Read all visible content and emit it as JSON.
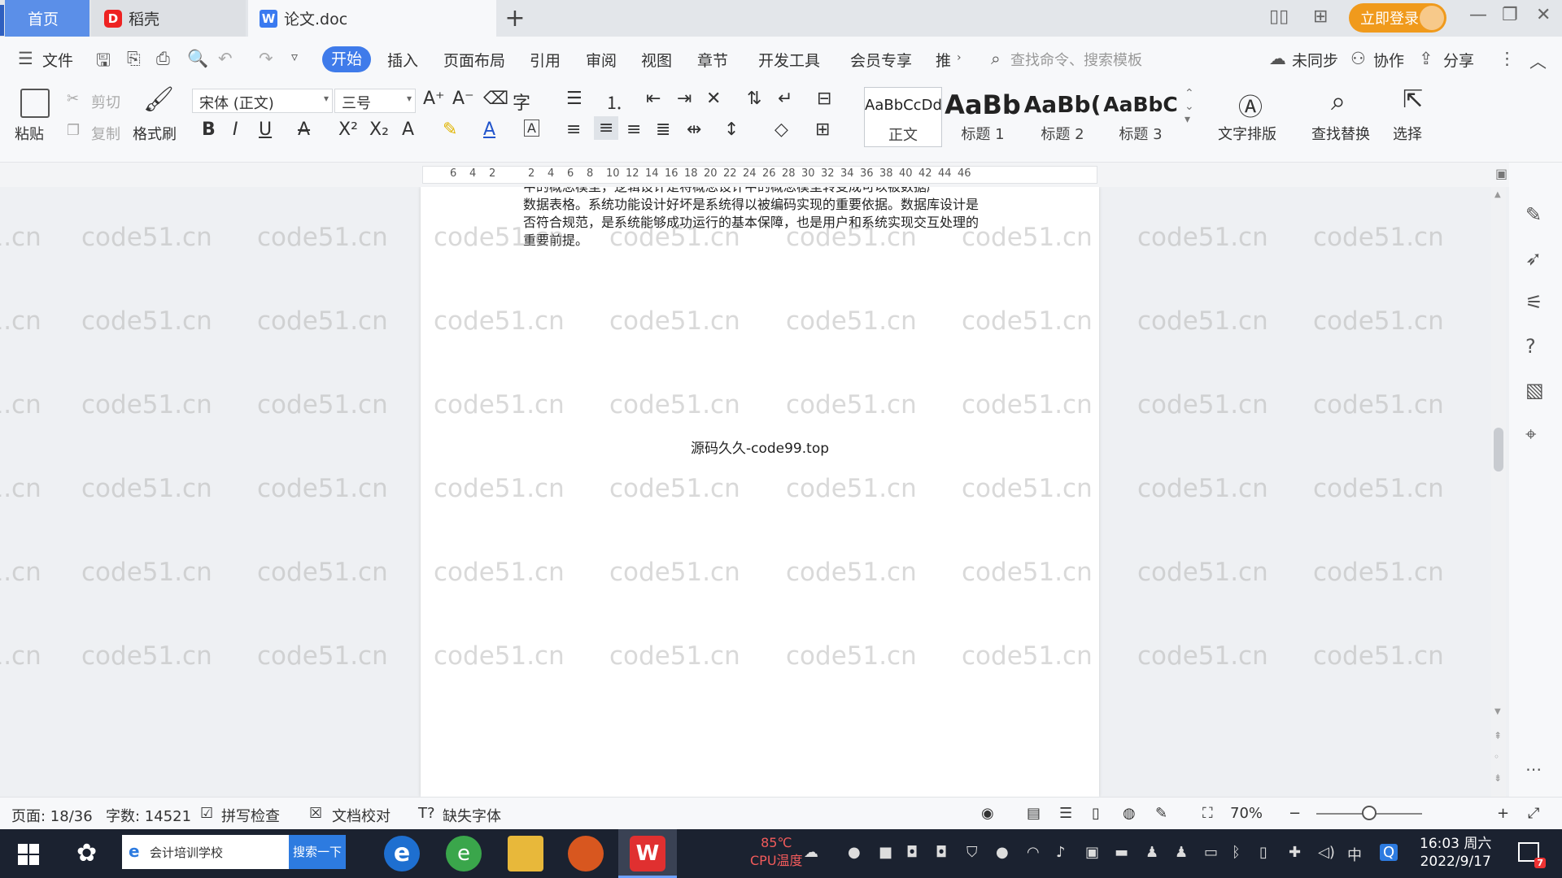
{
  "tabs": {
    "home": "首页",
    "daoke": "稻壳",
    "doc": "论文.doc",
    "add": "+"
  },
  "titlebar": {
    "login": "立即登录"
  },
  "menus": [
    "文件",
    "开始",
    "插入",
    "页面布局",
    "引用",
    "审阅",
    "视图",
    "章节",
    "开发工具",
    "会员专享",
    "推"
  ],
  "search": {
    "command": "查找命令、搜索模板"
  },
  "collab": {
    "sync": "未同步",
    "cooperate": "协作",
    "share": "分享"
  },
  "ribbon": {
    "paste": "粘贴",
    "cut": "剪切",
    "copy": "复制",
    "format_painter": "格式刷",
    "font": "宋体 (正文)",
    "size": "三号",
    "styles": [
      {
        "preview": "AaBbCcDd",
        "name": "正文"
      },
      {
        "preview": "AaBb",
        "name": "标题 1"
      },
      {
        "preview": "AaBb(",
        "name": "标题 2"
      },
      {
        "preview": "AaBbC",
        "name": "标题 3"
      }
    ],
    "text_layout": "文字排版",
    "find_replace": "查找替换",
    "select": "选择"
  },
  "ruler": [
    "6",
    "4",
    "2",
    "2",
    "4",
    "6",
    "8",
    "10",
    "12",
    "14",
    "16",
    "18",
    "20",
    "22",
    "24",
    "26",
    "28",
    "30",
    "32",
    "34",
    "36",
    "38",
    "40",
    "42",
    "44",
    "46"
  ],
  "document": {
    "line1": "中的概念模型，逻辑设计是将概念设计中的概念模型转变成可以被数据库存储的",
    "line2": "数据表格。系统功能设计好坏是系统得以被编码实现的重要依据。数据库设计是",
    "line3": "否符合规范，是系统能够成功运行的基本保障，也是用户和系统实现交互处理的",
    "line4": "重要前提。",
    "footer": "源码久久-code99.top",
    "watermark": "code51.cn"
  },
  "status": {
    "page": "页面: 18/36",
    "words": "字数: 14521",
    "spell": "拼写检查",
    "proof": "文档校对",
    "missing_font": "缺失字体",
    "zoom": "70%"
  },
  "taskbar": {
    "search_text": "会计培训学校",
    "search_button": "搜索一下",
    "temp": "85℃",
    "temp_label": "CPU温度",
    "ime": "中",
    "time": "16:03 周六",
    "date": "2022/9/17",
    "notifications": "7"
  },
  "colors": {
    "accent": "#3f7bea",
    "login": "#f09a1c",
    "taskbar": "#1b2230"
  }
}
